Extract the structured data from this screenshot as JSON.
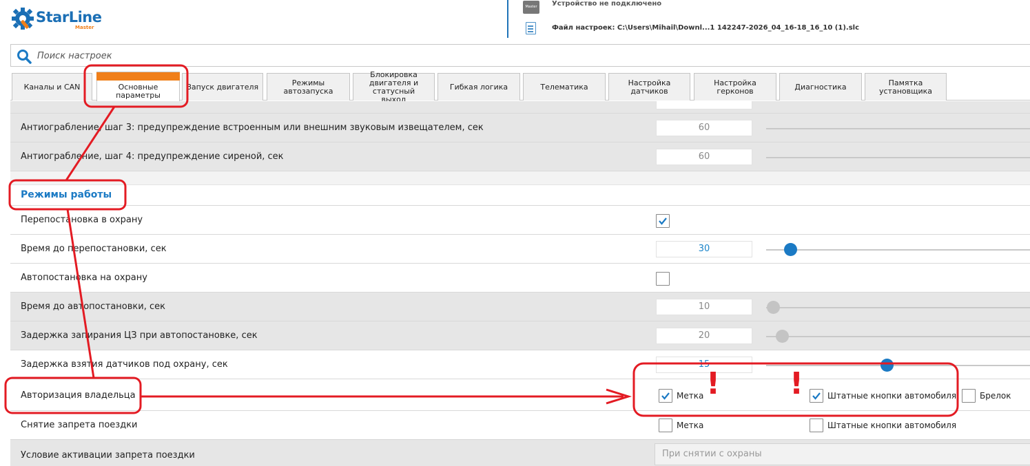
{
  "app": {
    "logo_text": "StarLine",
    "logo_sub": "Master",
    "device_status": "Устройство не подключено",
    "device_icon_text": "Master",
    "file_info": "Файл настроек: C:\\Users\\Mihail\\Downl...1 142247-2026_04_16-18_16_10 (1).slc"
  },
  "search": {
    "placeholder": "Поиск настроек"
  },
  "tabs": [
    {
      "label": "Каналы и CAN"
    },
    {
      "label": "Основные параметры"
    },
    {
      "label": "Запуск двигателя"
    },
    {
      "label": "Режимы автозапуска"
    },
    {
      "label": "Блокировка двигателя и статусный выход"
    },
    {
      "label": "Гибкая логика"
    },
    {
      "label": "Телематика"
    },
    {
      "label": "Настройка датчиков"
    },
    {
      "label": "Настройка герконов"
    },
    {
      "label": "Диагностика"
    },
    {
      "label": "Памятка установщика"
    }
  ],
  "rows": {
    "antirob3": {
      "label": "Антиограбление, шаг 3: предупреждение встроенным или внешним звуковым извещателем, сек",
      "value": "60"
    },
    "antirob4": {
      "label": "Антиограбление, шаг 4: предупреждение сиреной, сек",
      "value": "60"
    },
    "section": {
      "title": "Режимы работы"
    },
    "rearm": {
      "label": "Перепостановка в охрану",
      "checked": true
    },
    "rearm_time": {
      "label": "Время до перепостановки, сек",
      "value": "30"
    },
    "autoarm": {
      "label": "Автопостановка на охрану",
      "checked": false
    },
    "autoarm_time": {
      "label": "Время до автопостановки, сек",
      "value": "10"
    },
    "lock_delay": {
      "label": "Задержка запирания ЦЗ при автопостановке, сек",
      "value": "20"
    },
    "sensor_delay": {
      "label": "Задержка взятия датчиков под охрану, сек",
      "value": "15"
    },
    "owner_auth": {
      "label": "Авторизация владельца",
      "options": [
        {
          "label": "Метка",
          "checked": true
        },
        {
          "label": "Штатные кнопки автомобиля",
          "checked": true
        },
        {
          "label": "Брелок",
          "checked": false
        }
      ]
    },
    "ban_removal": {
      "label": "Снятие запрета поездки",
      "options": [
        {
          "label": "Метка",
          "checked": false
        },
        {
          "label": "Штатные кнопки автомобиля",
          "checked": false
        }
      ]
    },
    "ban_condition": {
      "label": "Условие активации запрета поездки",
      "value": "При снятии с охраны"
    }
  },
  "annotation": {
    "mark": "!"
  },
  "colors": {
    "brand_blue": "#1b7ac4",
    "accent_orange": "#f07f1a",
    "annotation_red": "#e31b23"
  }
}
